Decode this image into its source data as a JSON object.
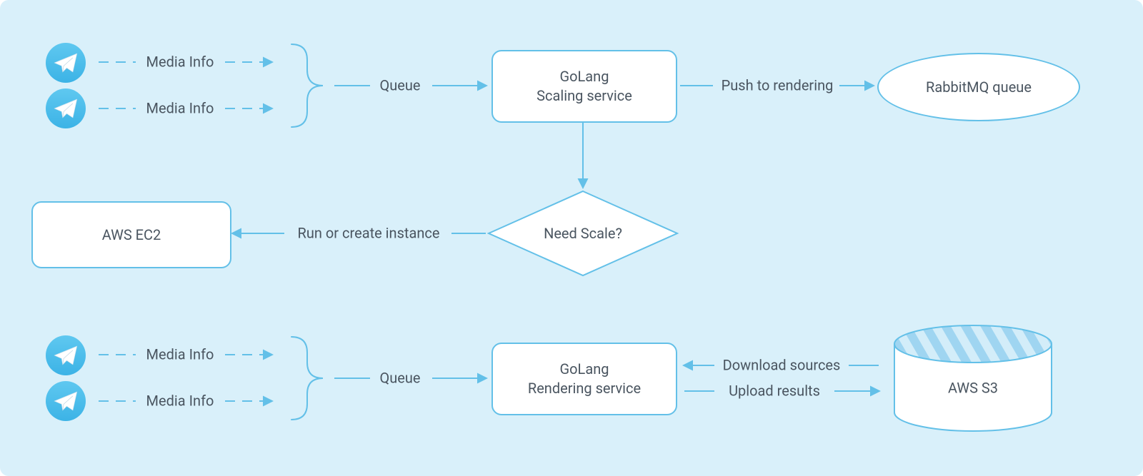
{
  "labels": {
    "media_info": "Media Info",
    "queue_top": "Queue",
    "queue_bottom": "Queue",
    "push_rendering": "Push to rendering",
    "run_create": "Run or create instance",
    "download_sources": "Download sources",
    "upload_results": "Upload results"
  },
  "nodes": {
    "golang_scaling_l1": "GoLang",
    "golang_scaling_l2": "Scaling service",
    "golang_rendering_l1": "GoLang",
    "golang_rendering_l2": "Rendering service",
    "rabbitmq": "RabbitMQ queue",
    "ec2": "AWS EC2",
    "s3": "AWS S3",
    "need_scale": "Need Scale?"
  }
}
